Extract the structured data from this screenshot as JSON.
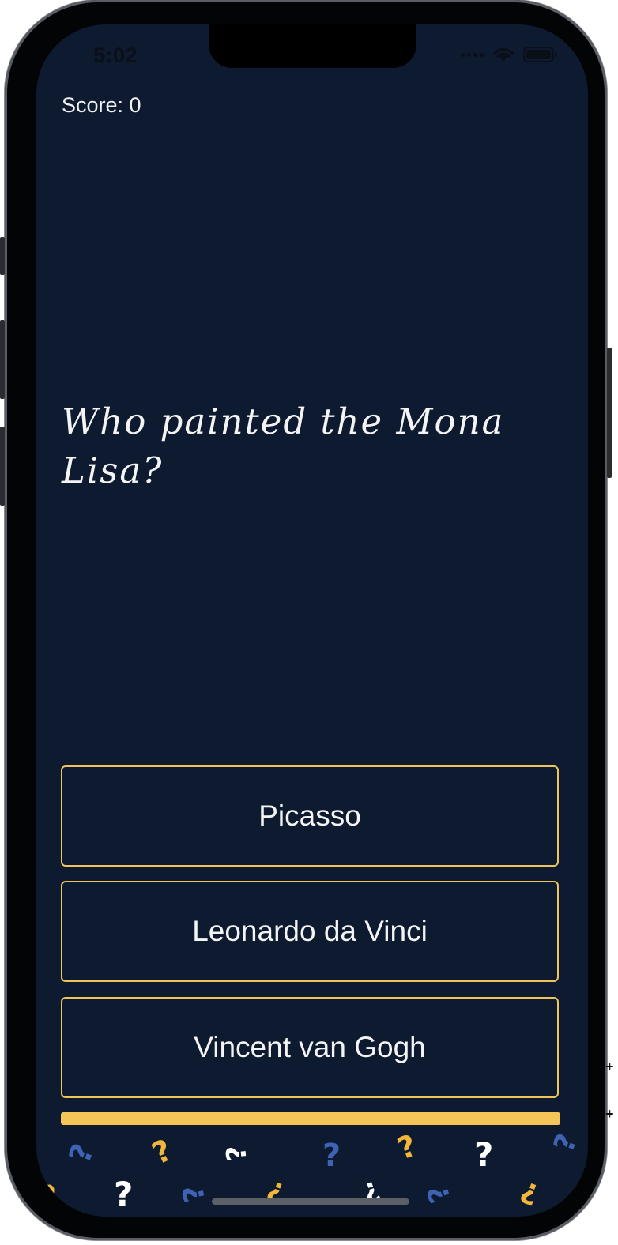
{
  "status_bar": {
    "time": "5:02"
  },
  "quiz": {
    "score_label": "Score: 0",
    "question": "Who painted the Mona Lisa?",
    "answers": [
      {
        "label": "Picasso"
      },
      {
        "label": "Leonardo da Vinci"
      },
      {
        "label": "Vincent van Gogh"
      }
    ],
    "progress": 1.0
  },
  "decorations": {
    "glyph": "?",
    "colors": {
      "blue": "#3e63b4",
      "yellow": "#f2b63a",
      "white": "#ffffff"
    }
  },
  "colors": {
    "background": "#0d1a30",
    "accent": "#f0c45a",
    "text": "#f4f4f4"
  }
}
